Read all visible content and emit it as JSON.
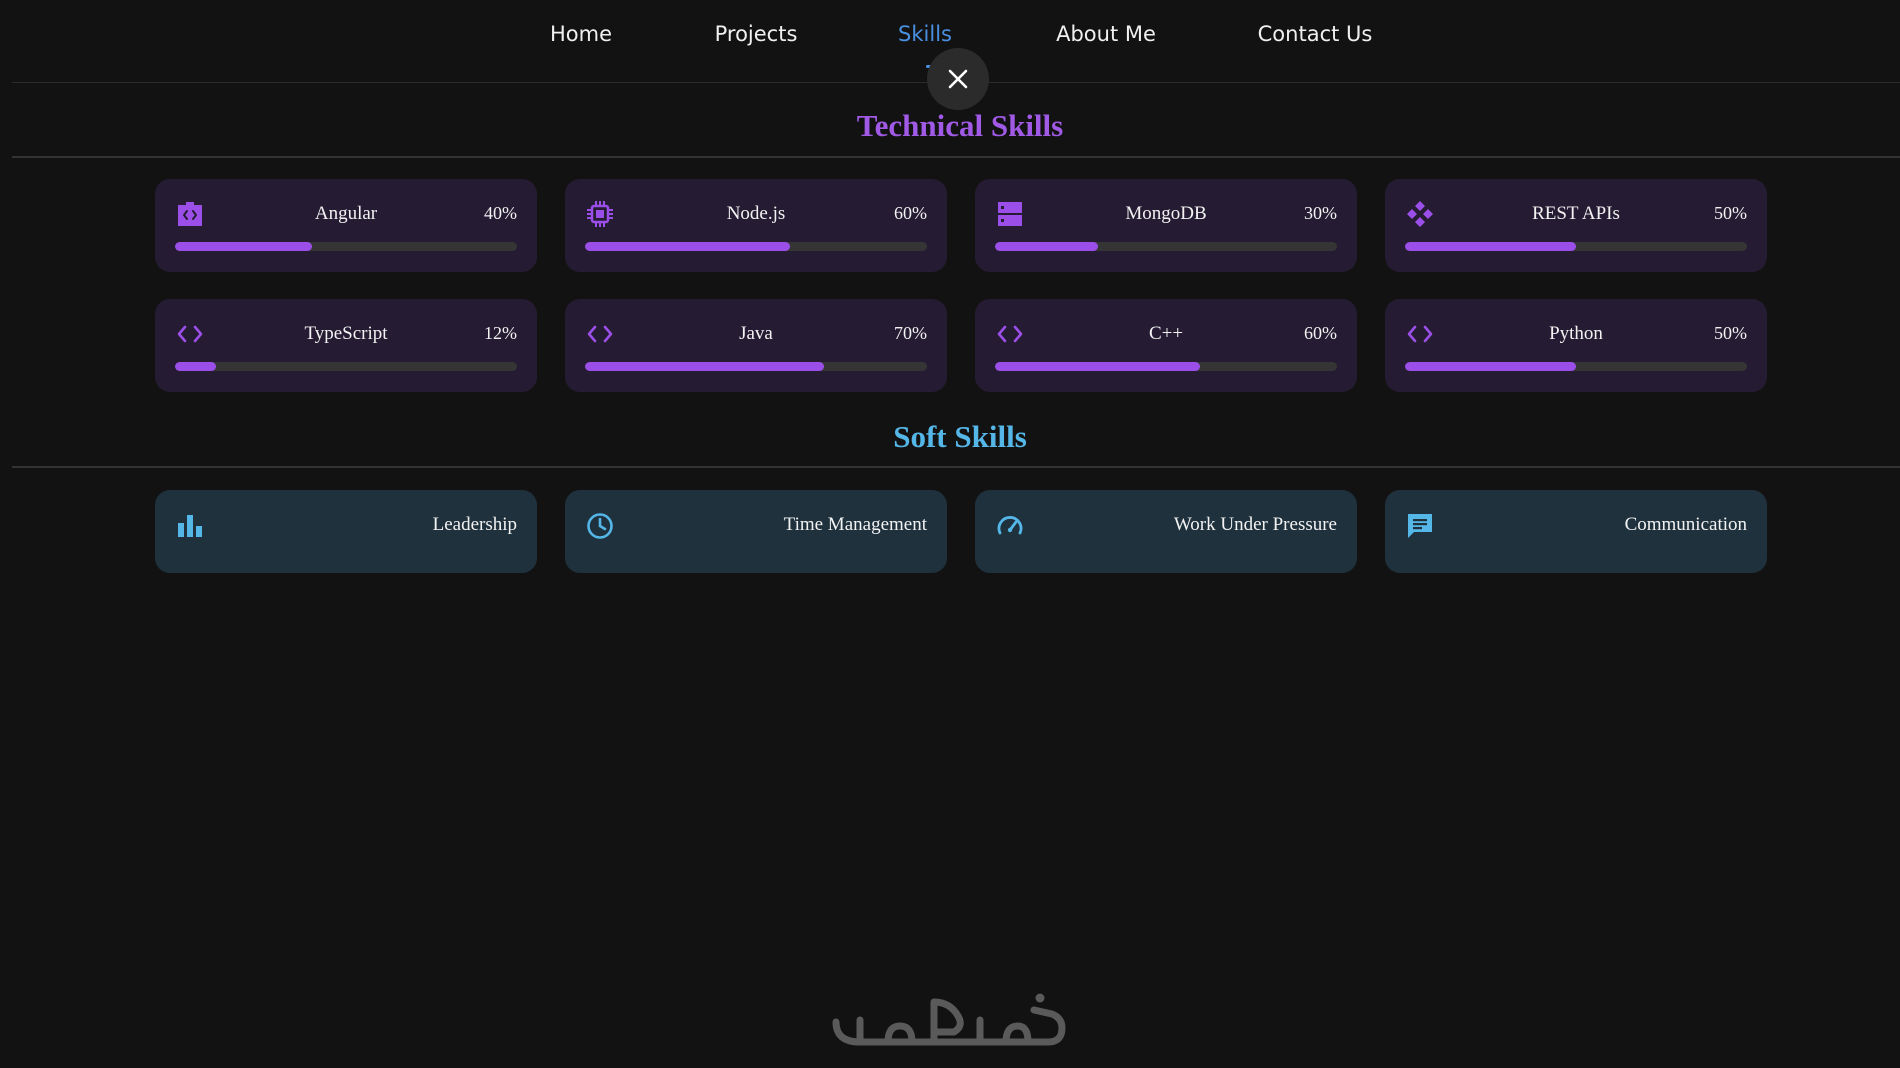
{
  "nav": {
    "items": [
      {
        "label": "Home",
        "active": false
      },
      {
        "label": "Projects",
        "active": false
      },
      {
        "label": "Skills",
        "active": true
      },
      {
        "label": "About Me",
        "active": false
      },
      {
        "label": "Contact Us",
        "active": false
      }
    ]
  },
  "close_button_icon": "close-icon",
  "technical": {
    "title": "Technical Skills",
    "skills": [
      {
        "name": "Angular",
        "percent": "40%",
        "level": 40,
        "icon": "angular-icon"
      },
      {
        "name": "Node.js",
        "percent": "60%",
        "level": 60,
        "icon": "chip-icon"
      },
      {
        "name": "MongoDB",
        "percent": "30%",
        "level": 30,
        "icon": "database-icon"
      },
      {
        "name": "REST APIs",
        "percent": "50%",
        "level": 50,
        "icon": "api-icon"
      },
      {
        "name": "TypeScript",
        "percent": "12%",
        "level": 12,
        "icon": "code-icon"
      },
      {
        "name": "Java",
        "percent": "70%",
        "level": 70,
        "icon": "code-icon"
      },
      {
        "name": "C++",
        "percent": "60%",
        "level": 60,
        "icon": "code-icon"
      },
      {
        "name": "Python",
        "percent": "50%",
        "level": 50,
        "icon": "code-icon"
      }
    ]
  },
  "soft": {
    "title": "Soft Skills",
    "skills": [
      {
        "name": "Leadership",
        "icon": "bar-chart-icon"
      },
      {
        "name": "Time Management",
        "icon": "clock-icon"
      },
      {
        "name": "Work Under Pressure",
        "icon": "speedometer-icon"
      },
      {
        "name": "Communication",
        "icon": "chat-icon"
      }
    ]
  },
  "colors": {
    "background": "#121212",
    "accent_purple": "#9b4fe8",
    "accent_blue": "#55b6e8",
    "nav_active": "#4a90e2",
    "tech_card_bg": "#251c33",
    "soft_card_bg": "#1f313d"
  },
  "footer": {
    "logo": "Khamsat",
    "logo_icon": "khamsat-logo"
  }
}
